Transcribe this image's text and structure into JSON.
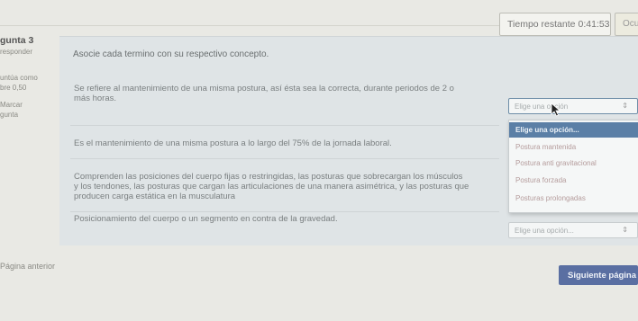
{
  "timer": {
    "label": "Tiempo restante",
    "value": "0:41:53"
  },
  "hide_button": "Ocu",
  "question": {
    "number": "gunta 3",
    "status": "responder",
    "points_line1": "untúa como",
    "points_line2": "bre 0,50",
    "flag_line1": "Marcar",
    "flag_line2": "gunta",
    "prompt": "Asocie cada termino con su respectivo concepto."
  },
  "items": [
    {
      "text_line1": "Se refiere al mantenimiento de una misma postura, así ésta sea la correcta, durante periodos de 2 o",
      "text_line2": "más horas.",
      "select_text": "Elige una opción"
    },
    {
      "text": "Es el mantenimiento de una misma postura a lo largo del 75% de la jornada laboral.",
      "select_text": "Elige una opción..."
    },
    {
      "text_line1": "Comprenden las posiciones del cuerpo fijas o restringidas, las posturas que sobrecargan los músculos",
      "text_line2": "y los tendones, las posturas que cargan las articulaciones de una manera asimétrica, y las posturas que",
      "text_line3": "producen carga estática en la musculatura",
      "select_text": ""
    },
    {
      "text": "Posicionamiento del cuerpo o un segmento en contra de la gravedad.",
      "select_text": "Elige una opción..."
    }
  ],
  "dropdown_options": [
    "Elige una opción...",
    "Postura mantenida",
    "Postura anti gravitacional",
    "Postura forzada",
    "Posturas prolongadas"
  ],
  "nav": {
    "prev": "Página anterior",
    "next": "Siguiente página"
  },
  "colors": {
    "accent": "#5a6fa2",
    "selected_option": "#5b7fa6"
  }
}
